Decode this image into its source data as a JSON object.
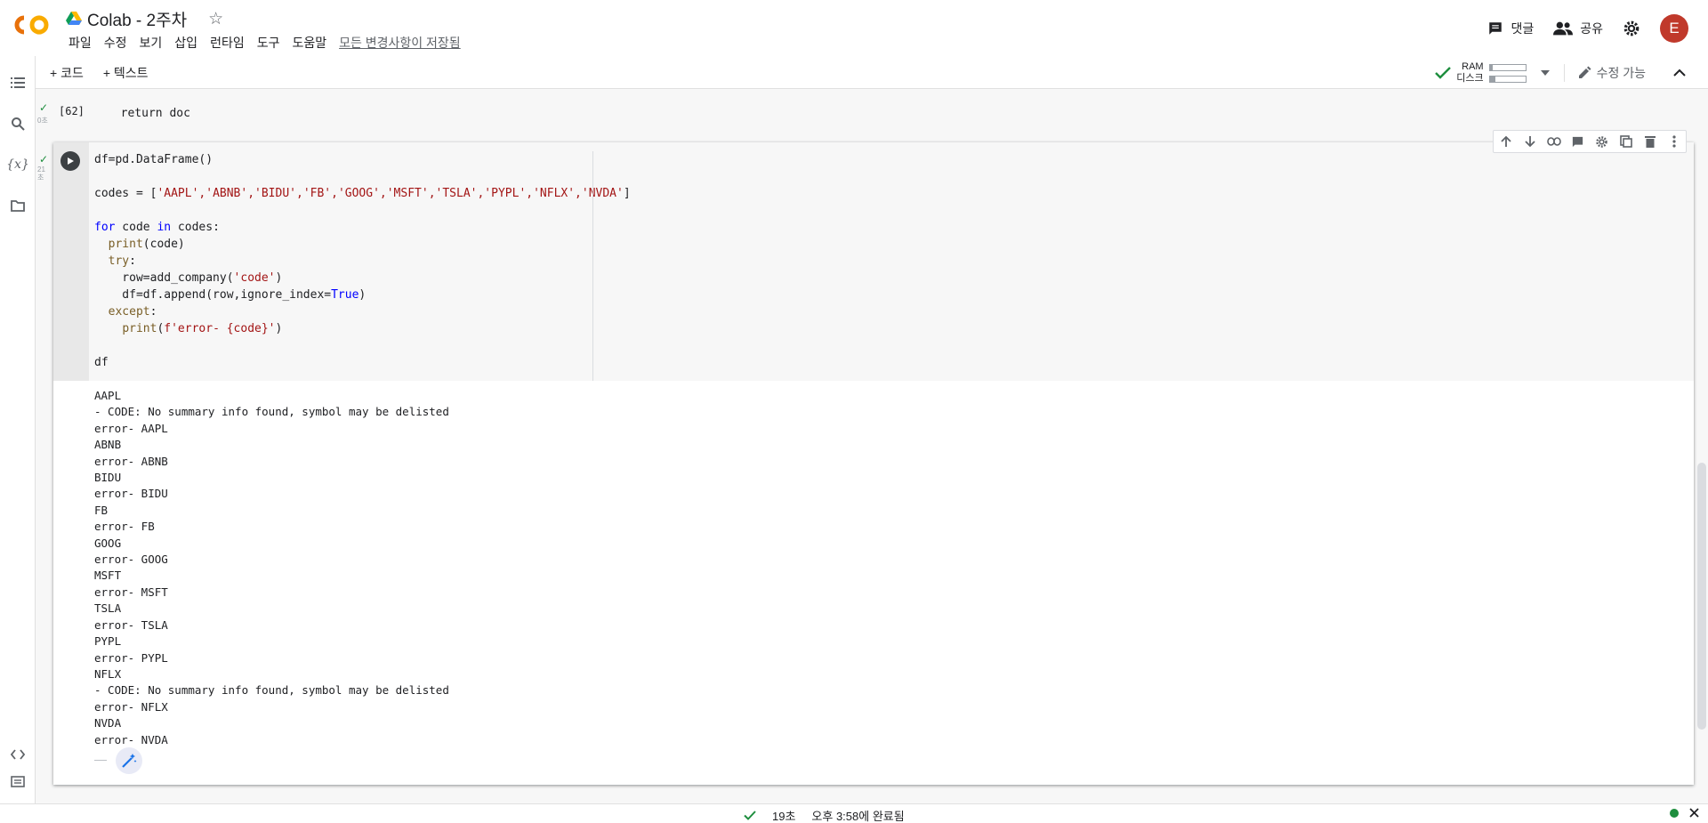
{
  "header": {
    "title": "Colab - 2주차",
    "menu": [
      "파일",
      "수정",
      "보기",
      "삽입",
      "런타임",
      "도구",
      "도움말"
    ],
    "saved_status": "모든 변경사항이 저장됨",
    "comment_label": "댓글",
    "share_label": "공유",
    "avatar_letter": "E",
    "logo_text": "CO"
  },
  "toolbar": {
    "add_code": "+ 코드",
    "add_text": "+ 텍스트",
    "ram_label": "RAM",
    "disk_label": "디스크",
    "ram_fill": 0.08,
    "disk_fill": 0.15,
    "edit_mode": "수정 가능"
  },
  "rail": {
    "icons": [
      "toc-icon",
      "search-icon",
      "variables-icon",
      "folder-icon",
      "code-snippets-icon",
      "terminal-icon"
    ],
    "variables_glyph": "{x}"
  },
  "cells": {
    "prev": {
      "count": "[62]",
      "time": "0초",
      "code": "  return doc"
    },
    "main": {
      "time": "21초",
      "code_lines": [
        "df=pd.DataFrame()",
        "",
        "codes = ['AAPL','ABNB','BIDU','FB','GOOG','MSFT','TSLA','PYPL','NFLX','NVDA']",
        "",
        "for code in codes:",
        "  print(code)",
        "  try:",
        "    row=add_company('code')",
        "    df=df.append(row,ignore_index=True)",
        "  except:",
        "    print(f'error- {code}')",
        "",
        "df"
      ],
      "output_lines": [
        "AAPL",
        "- CODE: No summary info found, symbol may be delisted",
        "error- AAPL",
        "ABNB",
        "error- ABNB",
        "BIDU",
        "error- BIDU",
        "FB",
        "error- FB",
        "GOOG",
        "error- GOOG",
        "MSFT",
        "error- MSFT",
        "TSLA",
        "error- TSLA",
        "PYPL",
        "error- PYPL",
        "NFLX",
        "- CODE: No summary info found, symbol may be delisted",
        "error- NFLX",
        "NVDA",
        "error- NVDA"
      ]
    }
  },
  "status": {
    "duration": "19초",
    "completed": "오후 3:58에 완료됨"
  },
  "colors": {
    "accent_orange": "#f9ab00",
    "success_green": "#1e8e3e",
    "avatar_red": "#c0392b"
  }
}
